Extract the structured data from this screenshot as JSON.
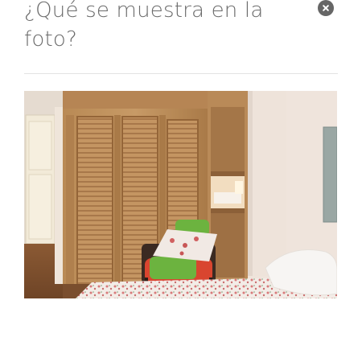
{
  "dialog": {
    "title": "¿Qué se muestra en la foto?",
    "close_icon": "close-icon",
    "photo_alt": "Habitación con armario de madera, sillón con cojines y cama"
  },
  "colors": {
    "title_text": "#6b6b6b",
    "close_button_bg": "#666666",
    "divider": "#e3e3e3"
  }
}
